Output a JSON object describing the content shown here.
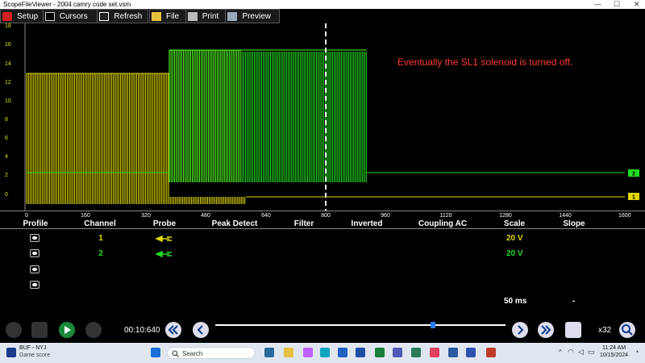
{
  "window": {
    "title": "ScopeFileViewer - 2004 camry code set.vsm",
    "min": "—",
    "max": "☐",
    "close": "✕"
  },
  "toolbar": {
    "setup": "Setup",
    "cursors": "Cursors",
    "refresh": "Refresh",
    "file": "File",
    "print": "Print",
    "preview": "Preview"
  },
  "annotation": "Eventually the SL1 solenoid is turned off.",
  "colors": {
    "ch1": "#e0d800",
    "ch2": "#22dd22",
    "ch2_bright": "#55ff22",
    "annotation": "#ff3b30"
  },
  "y_labels": [
    "18",
    "16",
    "14",
    "12",
    "10",
    "8",
    "6",
    "4",
    "2",
    "0"
  ],
  "x_labels": [
    "0",
    "160",
    "320",
    "480",
    "640",
    "800",
    "960",
    "1120",
    "1280",
    "1440",
    "1600 ms"
  ],
  "markers": {
    "ch1": "1",
    "ch2": "2"
  },
  "table": {
    "headers": [
      "Profile",
      "Channel",
      "Probe",
      "Peak Detect",
      "Filter",
      "Inverted",
      "Coupling AC",
      "Scale",
      "Slope"
    ],
    "rows": [
      {
        "channel": "1",
        "scale": "20 V",
        "color": "#e0d800"
      },
      {
        "channel": "2",
        "scale": "20 V",
        "color": "#22dd22"
      },
      {
        "channel": "",
        "scale": ""
      },
      {
        "channel": "",
        "scale": ""
      }
    ],
    "timebase": "50 ms",
    "slope": "-"
  },
  "controls": {
    "time": "00:10:640",
    "speed": "x32"
  },
  "taskbar": {
    "weather_title": "BUF - NYJ",
    "weather_sub": "Game score",
    "search": "Search",
    "time": "11:24 AM",
    "date": "10/15/2024"
  }
}
